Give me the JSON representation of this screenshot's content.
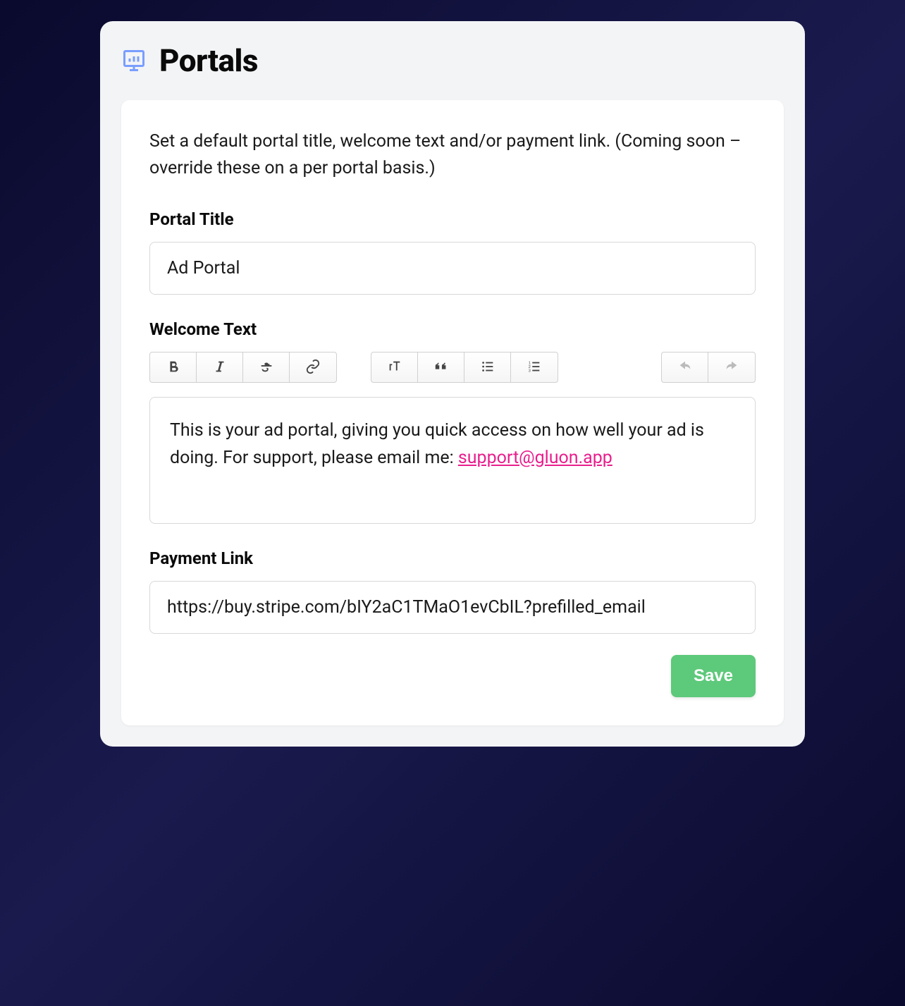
{
  "header": {
    "title": "Portals",
    "icon": "presentation-chart-icon"
  },
  "description": "Set a default portal title, welcome text and/or payment link. (Coming soon – override these on a per portal basis.)",
  "fields": {
    "portal_title": {
      "label": "Portal Title",
      "value": "Ad Portal"
    },
    "welcome_text": {
      "label": "Welcome Text",
      "body": "This is your ad portal, giving you quick access on how well your ad is doing. For support, please email me: ",
      "link_text": "support@gluon.app"
    },
    "payment_link": {
      "label": "Payment Link",
      "value": "https://buy.stripe.com/bIY2aC1TMaO1evCbIL?prefilled_email"
    }
  },
  "toolbar": {
    "bold": "Bold",
    "italic": "Italic",
    "strike": "Strikethrough",
    "link": "Link",
    "heading": "Heading",
    "quote": "Quote",
    "bullet_list": "Bullet List",
    "number_list": "Numbered List",
    "undo": "Undo",
    "redo": "Redo"
  },
  "buttons": {
    "save": "Save"
  }
}
